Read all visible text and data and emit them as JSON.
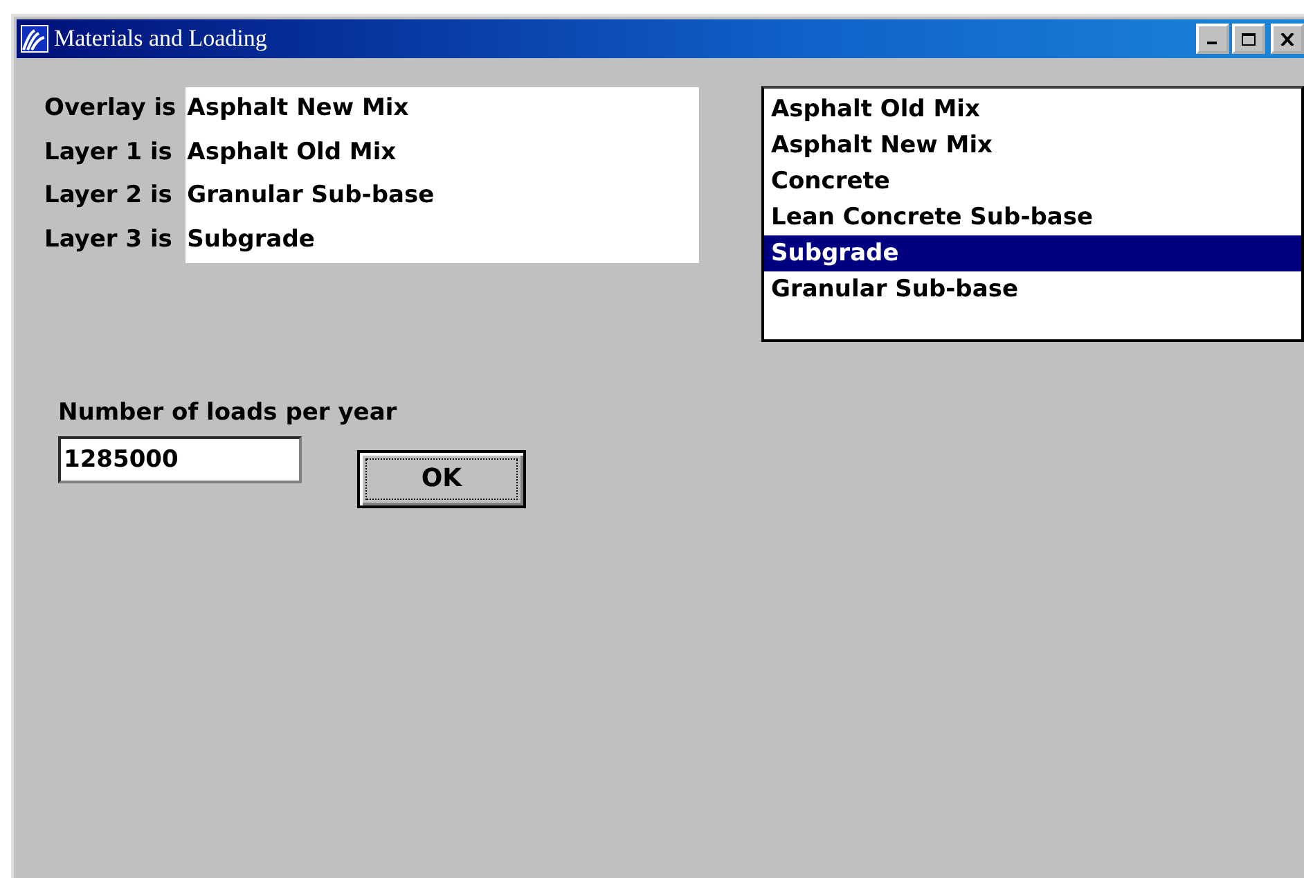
{
  "window": {
    "title": "Materials and Loading"
  },
  "layers": [
    {
      "label": "Overlay is",
      "material": "Asphalt New Mix"
    },
    {
      "label": "Layer 1 is",
      "material": "Asphalt Old Mix"
    },
    {
      "label": "Layer 2 is",
      "material": "Granular Sub-base"
    },
    {
      "label": "Layer 3 is",
      "material": "Subgrade"
    }
  ],
  "materials_list": [
    {
      "label": "Asphalt Old Mix",
      "selected": false
    },
    {
      "label": "Asphalt New Mix",
      "selected": false
    },
    {
      "label": "Concrete",
      "selected": false
    },
    {
      "label": "Lean Concrete Sub-base",
      "selected": false
    },
    {
      "label": "Subgrade",
      "selected": true
    },
    {
      "label": "Granular Sub-base",
      "selected": false
    }
  ],
  "loads": {
    "label": "Number of loads per year",
    "value": "1285000"
  },
  "buttons": [
    "OK"
  ]
}
